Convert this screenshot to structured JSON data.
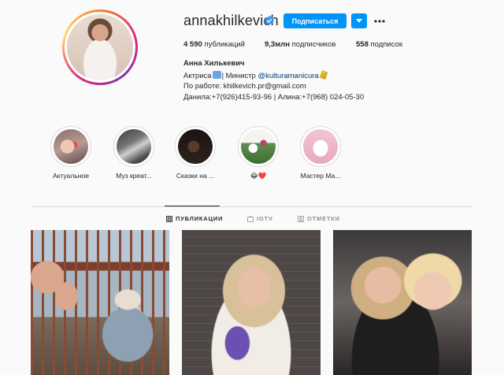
{
  "profile": {
    "username": "annakhilkevich",
    "follow_label": "Подписаться",
    "stats": {
      "posts_count": "4 590",
      "posts_label": " публикаций",
      "followers_count": "9,3млн",
      "followers_label": " подписчиков",
      "following_count": "558",
      "following_label": " подписок"
    },
    "full_name": "Анна Хилькевич",
    "bio": {
      "line1_prefix": "Актриса",
      "line1_middle": "| Министр ",
      "line1_mention": "@kulturamanicura",
      "line2": "По работе: khilkevich.pr@gmail.com",
      "line3": "Данила:+7(926)415-93-96 | Алина:+7(968) 024-05-30"
    }
  },
  "highlights": [
    {
      "label": "Актуальное"
    },
    {
      "label": "Муз креат..."
    },
    {
      "label": "Сказки на ..."
    },
    {
      "label": "😂❤️"
    },
    {
      "label": "Мастер Ма..."
    }
  ],
  "tabs": [
    {
      "label": "ПУБЛИКАЦИИ",
      "active": true
    },
    {
      "label": "IGTV",
      "active": false
    },
    {
      "label": "ОТМЕТКИ",
      "active": false
    }
  ],
  "colors": {
    "accent": "#0095f6",
    "verified": "#3897f0"
  },
  "icons": {
    "verified": "verified-badge-icon",
    "dropdown": "chevron-down-icon",
    "more": "more-dots-icon",
    "grid": "grid-icon",
    "igtv": "igtv-icon",
    "tagged": "tag-icon"
  }
}
